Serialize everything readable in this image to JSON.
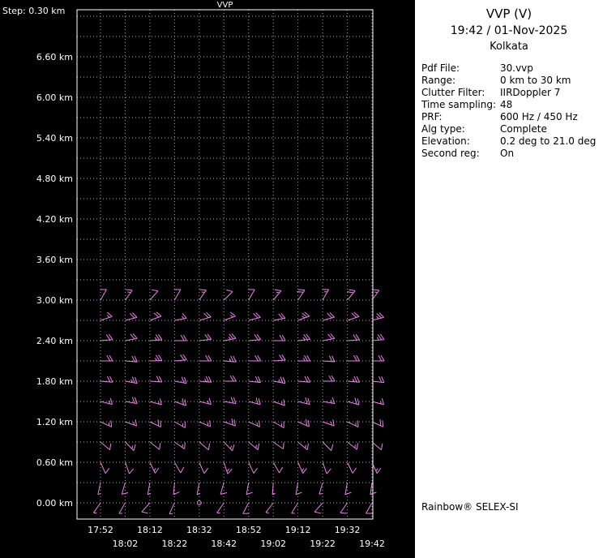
{
  "step_label": "Step: 0.30 km",
  "panel": {
    "title": "VVP (V)",
    "datetime": "19:42 / 01-Nov-2025",
    "site": "Kolkata",
    "info": [
      {
        "label": "Pdf File:",
        "value": "30.vvp"
      },
      {
        "label": "Range:",
        "value": "0 km to 30 km"
      },
      {
        "label": "Clutter Filter:",
        "value": "IIRDoppler 7"
      },
      {
        "label": "Time sampling:",
        "value": "48"
      },
      {
        "label": "PRF:",
        "value": "600 Hz / 450 Hz"
      },
      {
        "label": "Alg type:",
        "value": "Complete"
      },
      {
        "label": "Elevation:",
        "value": "0.2 deg to 21.0 deg"
      },
      {
        "label": "Second reg:",
        "value": "On"
      }
    ],
    "footer": "Rainbow® SELEX-SI"
  },
  "chart_data": {
    "type": "wind-profile",
    "title": "VVP",
    "x_ticks": [
      "17:52",
      "18:02",
      "18:12",
      "18:22",
      "18:32",
      "18:42",
      "18:52",
      "19:02",
      "19:12",
      "19:22",
      "19:32",
      "19:42"
    ],
    "y_ticks": [
      "6.60 km",
      "6.00 km",
      "5.40 km",
      "4.80 km",
      "4.20 km",
      "3.60 km",
      "3.00 km",
      "2.40 km",
      "1.80 km",
      "1.20 km",
      "0.60 km",
      "0.00 km"
    ],
    "y_step_km": 0.3,
    "y_range_km": [
      0.0,
      7.2
    ],
    "grid": "dotted",
    "barb_color": "#ee82ee",
    "axis_color": "#ffffff",
    "grid_color": "#aaaaaa",
    "rows": [
      {
        "alt_km": 0.0,
        "barbs": [
          [
            215,
            5
          ],
          [
            210,
            5
          ],
          [
            222,
            10
          ],
          [
            205,
            5
          ],
          [
            0,
            0
          ],
          [
            215,
            5
          ],
          [
            208,
            10
          ],
          [
            218,
            5
          ],
          [
            212,
            5
          ],
          [
            222,
            10
          ],
          [
            215,
            10
          ],
          [
            210,
            10
          ]
        ]
      },
      {
        "alt_km": 0.3,
        "barbs": [
          [
            192,
            5
          ],
          [
            196,
            10
          ],
          [
            190,
            5
          ],
          [
            185,
            10
          ],
          [
            190,
            5
          ],
          [
            196,
            10
          ],
          [
            190,
            10
          ],
          [
            184,
            5
          ],
          [
            190,
            10
          ],
          [
            196,
            5
          ],
          [
            190,
            10
          ],
          [
            188,
            10
          ]
        ]
      },
      {
        "alt_km": 0.6,
        "barbs": [
          [
            156,
            10
          ],
          [
            160,
            10
          ],
          [
            154,
            15
          ],
          [
            150,
            10
          ],
          [
            156,
            10
          ],
          [
            162,
            15
          ],
          [
            155,
            10
          ],
          [
            150,
            10
          ],
          [
            156,
            15
          ],
          [
            160,
            10
          ],
          [
            154,
            10
          ],
          [
            156,
            15
          ]
        ]
      },
      {
        "alt_km": 0.9,
        "barbs": [
          [
            130,
            10
          ],
          [
            135,
            15
          ],
          [
            128,
            10
          ],
          [
            125,
            15
          ],
          [
            130,
            10
          ],
          [
            136,
            15
          ],
          [
            130,
            15
          ],
          [
            125,
            10
          ],
          [
            130,
            15
          ],
          [
            135,
            10
          ],
          [
            128,
            15
          ],
          [
            130,
            10
          ]
        ]
      },
      {
        "alt_km": 1.2,
        "barbs": [
          [
            115,
            15
          ],
          [
            110,
            15
          ],
          [
            116,
            20
          ],
          [
            120,
            15
          ],
          [
            114,
            15
          ],
          [
            110,
            20
          ],
          [
            115,
            15
          ],
          [
            120,
            15
          ],
          [
            114,
            20
          ],
          [
            110,
            15
          ],
          [
            116,
            15
          ],
          [
            115,
            20
          ]
        ]
      },
      {
        "alt_km": 1.5,
        "barbs": [
          [
            104,
            15
          ],
          [
            100,
            20
          ],
          [
            106,
            15
          ],
          [
            110,
            20
          ],
          [
            104,
            15
          ],
          [
            100,
            20
          ],
          [
            105,
            20
          ],
          [
            110,
            15
          ],
          [
            104,
            20
          ],
          [
            100,
            15
          ],
          [
            106,
            20
          ],
          [
            105,
            15
          ]
        ]
      },
      {
        "alt_km": 1.8,
        "barbs": [
          [
            95,
            20
          ],
          [
            100,
            25
          ],
          [
            94,
            20
          ],
          [
            100,
            20
          ],
          [
            95,
            25
          ],
          [
            90,
            20
          ],
          [
            96,
            20
          ],
          [
            100,
            25
          ],
          [
            95,
            20
          ],
          [
            90,
            20
          ],
          [
            95,
            25
          ],
          [
            96,
            20
          ]
        ]
      },
      {
        "alt_km": 2.1,
        "barbs": [
          [
            90,
            20
          ],
          [
            95,
            20
          ],
          [
            88,
            25
          ],
          [
            85,
            20
          ],
          [
            90,
            20
          ],
          [
            95,
            25
          ],
          [
            90,
            20
          ],
          [
            86,
            20
          ],
          [
            90,
            25
          ],
          [
            94,
            20
          ],
          [
            90,
            20
          ],
          [
            90,
            20
          ]
        ]
      },
      {
        "alt_km": 2.4,
        "barbs": [
          [
            85,
            20
          ],
          [
            80,
            20
          ],
          [
            86,
            25
          ],
          [
            90,
            20
          ],
          [
            84,
            20
          ],
          [
            80,
            25
          ],
          [
            85,
            20
          ],
          [
            90,
            20
          ],
          [
            84,
            25
          ],
          [
            80,
            20
          ],
          [
            86,
            20
          ],
          [
            85,
            25
          ]
        ]
      },
      {
        "alt_km": 2.7,
        "barbs": [
          [
            72,
            15
          ],
          [
            76,
            20
          ],
          [
            70,
            20
          ],
          [
            80,
            15
          ],
          [
            74,
            20
          ],
          [
            70,
            15
          ],
          [
            76,
            20
          ],
          [
            80,
            20
          ],
          [
            70,
            25
          ],
          [
            75,
            20
          ],
          [
            72,
            20
          ],
          [
            76,
            25
          ]
        ]
      },
      {
        "alt_km": 3.0,
        "barbs": [
          [
            30,
            10
          ],
          [
            36,
            15
          ],
          [
            42,
            10
          ],
          [
            30,
            10
          ],
          [
            35,
            15
          ],
          [
            46,
            10
          ],
          [
            30,
            10
          ],
          [
            40,
            15
          ],
          [
            34,
            20
          ],
          [
            30,
            15
          ],
          [
            40,
            20
          ],
          [
            36,
            15
          ]
        ]
      }
    ]
  }
}
